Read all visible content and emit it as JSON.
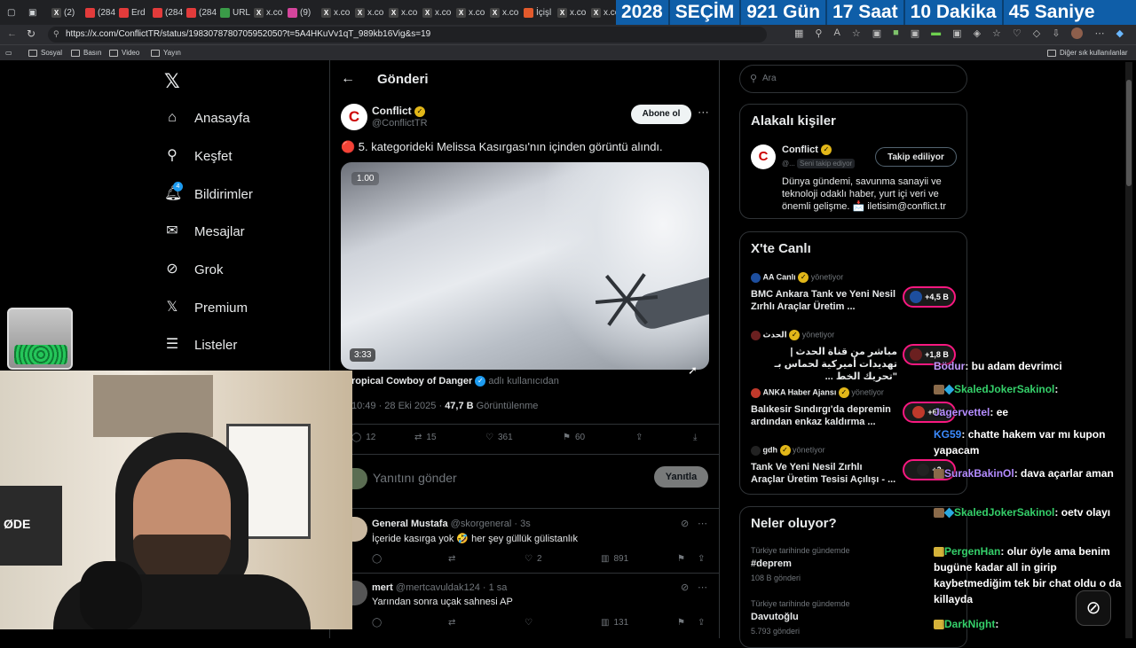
{
  "browser": {
    "tabs": [
      "(2)",
      "(284",
      "Erd",
      "(284",
      "(284",
      "URL",
      "x.co",
      "(9)",
      "x.co",
      "x.co",
      "x.co",
      "x.co",
      "x.co",
      "x.co",
      "İçişl",
      "x.co",
      "x.co"
    ],
    "url": "https://x.com/ConflictTR/status/1983078780705952050?t=5A4HKuVv1qT_989kb16Vig&s=19",
    "bookmarks": [
      "Sosyal",
      "Basın",
      "Video",
      "Yayın"
    ],
    "other_bookmarks": "Diğer sık kullanılanlar"
  },
  "countdown": {
    "year": "2028",
    "label": "SEÇİM",
    "days": "921 Gün",
    "hours": "17 Saat",
    "minutes": "10 Dakika",
    "seconds": "45 Saniye"
  },
  "nav": {
    "items": [
      "Anasayfa",
      "Keşfet",
      "Bildirimler",
      "Mesajlar",
      "Grok",
      "Premium",
      "Listeler"
    ],
    "notif_badge": "4"
  },
  "post": {
    "header": "Gönderi",
    "author": "Conflict",
    "handle": "@ConflictTR",
    "follow": "Abone ol",
    "text": "🔴 5. kategorideki Melissa Kasırgası'nın içinden görüntü alındı.",
    "video_speed": "1.00",
    "video_duration": "3:33",
    "credit_name": "ropical Cowboy of Danger",
    "credit_suffix": "adlı kullanıcıdan",
    "time": "10:49 · 28 Eki 2025 ·",
    "views": "47,7 B",
    "views_label": "Görüntülenme",
    "replies": "12",
    "reposts": "15",
    "likes": "361",
    "bookmarks": "60",
    "reply_placeholder": "Yanıtını gönder",
    "reply_button": "Yanıtla"
  },
  "replies": [
    {
      "name": "General Mustafa",
      "handle": "@skorgeneral · 3s",
      "text": "İçeride kasırga yok 🤣 her şey güllük gülistanlık",
      "likes": "2",
      "views": "891"
    },
    {
      "name": "mert",
      "handle": "@mertcavuldak124 · 1 sa",
      "text": "Yarından sonra uçak sahnesi AP",
      "likes": "",
      "views": "131"
    }
  ],
  "search": {
    "placeholder": "Ara"
  },
  "related": {
    "title": "Alakalı kişiler",
    "name": "Conflict",
    "handle": "@...",
    "follows_you": "Seni takip ediyor",
    "button": "Takip ediliyor",
    "bio": "Dünya gündemi, savunma sanayii ve teknoloji odaklı haber, yurt içi veri ve önemli gelişme. 📩 iletisim@conflict.tr"
  },
  "live": {
    "title": "X'te Canlı",
    "items": [
      {
        "host": "AA Canlı",
        "role": "yönetiyor",
        "text": "BMC Ankara Tank ve Yeni Nesil Zırhlı Araçlar Üretim ...",
        "count": "+4,5 B"
      },
      {
        "host": "الحدث",
        "role": "yönetiyor",
        "text": "مباشر من قناة الحدث | تهديدات أميركية لحماس بـ \"تحريك الخط ...",
        "count": "+1,8 B"
      },
      {
        "host": "ANKA Haber Ajansı",
        "role": "yönetiyor",
        "text": "Balıkesir Sındırgı'da depremin ardından enkaz kaldırma ...",
        "count": "+671"
      },
      {
        "host": "gdh",
        "role": "yönetiyor",
        "text": "Tank Ve Yeni Nesil Zırhlı Araçlar Üretim Tesisi Açılışı - ...",
        "count": "+2"
      }
    ]
  },
  "trends": {
    "title": "Neler oluyor?",
    "items": [
      {
        "context": "Türkiye tarihinde gündemde",
        "name": "#deprem",
        "count": "108 B gönderi"
      },
      {
        "context": "Türkiye tarihinde gündemde",
        "name": "Davutoğlu",
        "count": "5.793 gönderi"
      }
    ]
  },
  "chat": [
    {
      "user": "Bödur",
      "msg": "bu adam devrimci",
      "color": "#c39bff"
    },
    {
      "user": "SkaledJokerSakinol",
      "msg": "",
      "color": "#35d06a"
    },
    {
      "user": "Jagervettel",
      "msg": "ee",
      "color": "#b48cff"
    },
    {
      "user": "KG59",
      "msg": "chatte hakem var mı kupon yapacam",
      "color": "#3c8bff"
    },
    {
      "user": "SurakBakinOl",
      "msg": "dava açarlar aman",
      "color": "#b48cff"
    },
    {
      "user": "SkaledJokerSakinol",
      "msg": "oetv olayı",
      "color": "#35d06a"
    },
    {
      "user": "PergenHan",
      "msg": "olur öyle ama benim bugüne kadar all in girip kaybetmediğim tek bir chat oldu o da killayda",
      "color": "#35d06a"
    },
    {
      "user": "DarkNight",
      "msg": "",
      "color": "#35d06a"
    }
  ],
  "overlay": {
    "webcam_sign": "ØDE"
  }
}
